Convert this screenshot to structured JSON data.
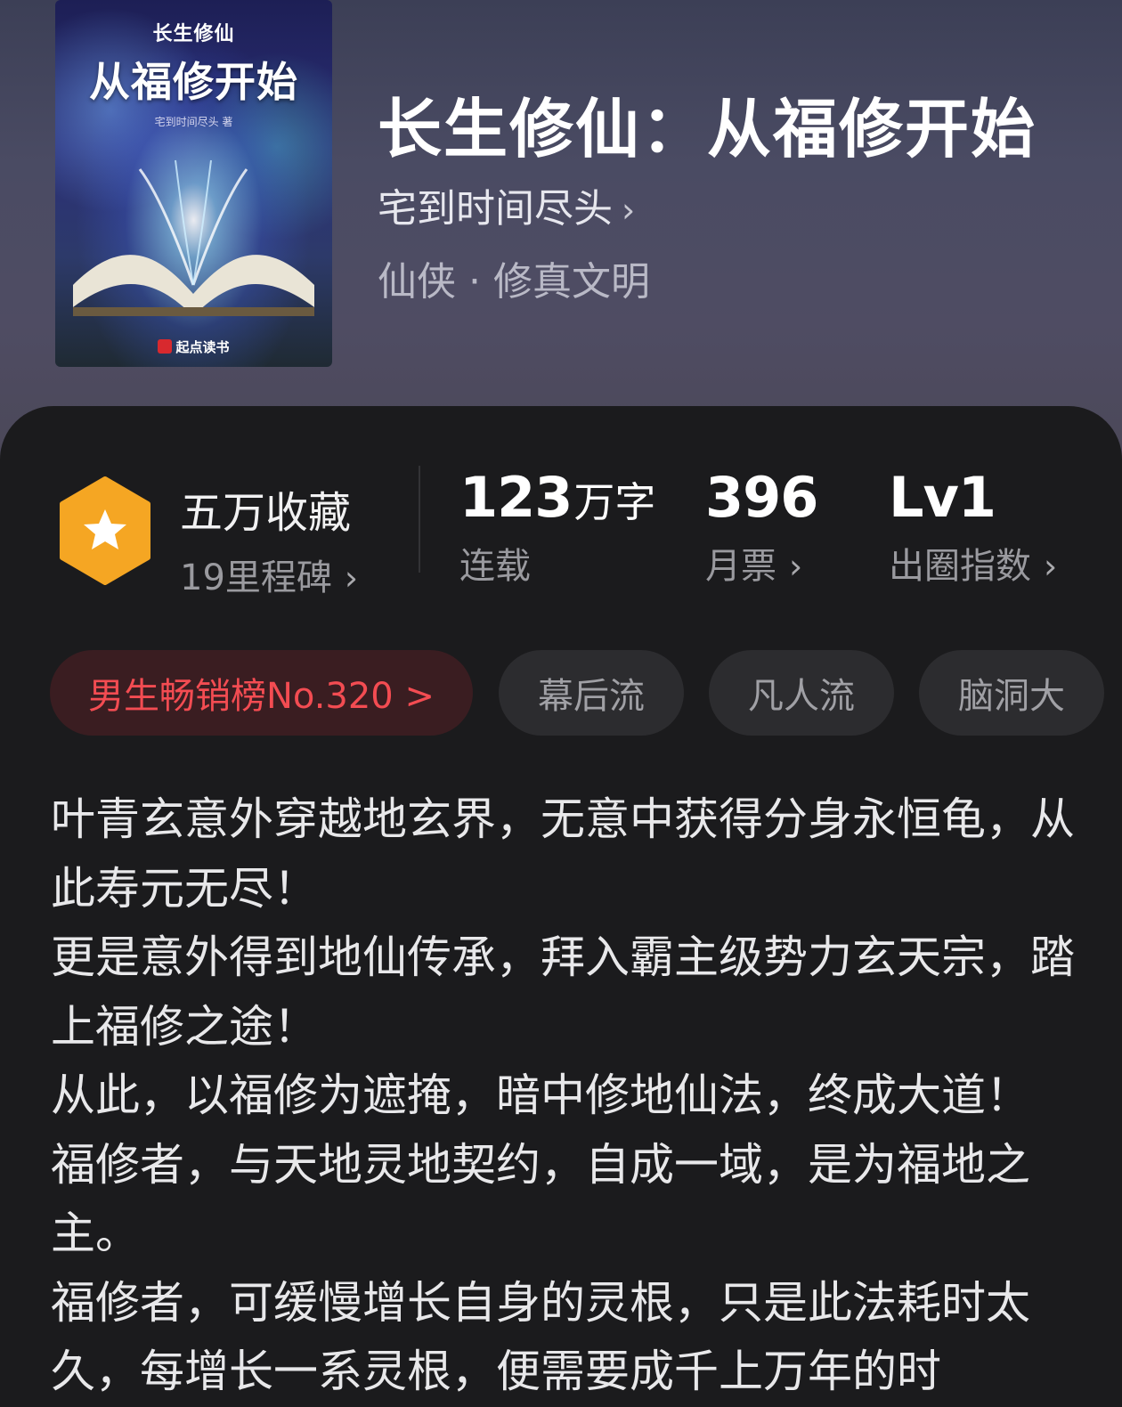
{
  "book": {
    "title": "长生修仙：从福修开始",
    "author": "宅到时间尽头",
    "genre": "仙侠 · 修真文明",
    "cover": {
      "series_label": "长生修仙",
      "title_label": "从福修开始",
      "author_label": "宅到时间尽头 著",
      "publisher": "起点读书"
    }
  },
  "stats": {
    "collection": {
      "label": "五万收藏",
      "sub": "19里程碑"
    },
    "words": {
      "value": "123",
      "unit": "万字",
      "sub": "连载"
    },
    "monthly_votes": {
      "value": "396",
      "sub": "月票"
    },
    "influence": {
      "value": "Lv1",
      "sub": "出圈指数"
    }
  },
  "tags": {
    "rank": "男生畅销榜No.320 >",
    "items": [
      "幕后流",
      "凡人流",
      "脑洞大"
    ]
  },
  "description": [
    "叶青玄意外穿越地玄界，无意中获得分身永恒龟，从此寿元无尽！",
    "更是意外得到地仙传承，拜入霸主级势力玄天宗，踏上福修之途！",
    "从此，以福修为遮掩，暗中修地仙法，终成大道！",
    "福修者，与天地灵地契约，自成一域，是为福地之主。",
    "福修者，可缓慢增长自身的灵根，只是此法耗时太久，每增长一系灵根，便需要成千上万年的时"
  ],
  "colors": {
    "accent_rank_text": "#f34c52",
    "badge_orange": "#f5a623",
    "panel_bg": "#1b1b1d"
  },
  "icons": {
    "badge": "star-hexagon-icon",
    "chevron": "chevron-right-icon"
  }
}
